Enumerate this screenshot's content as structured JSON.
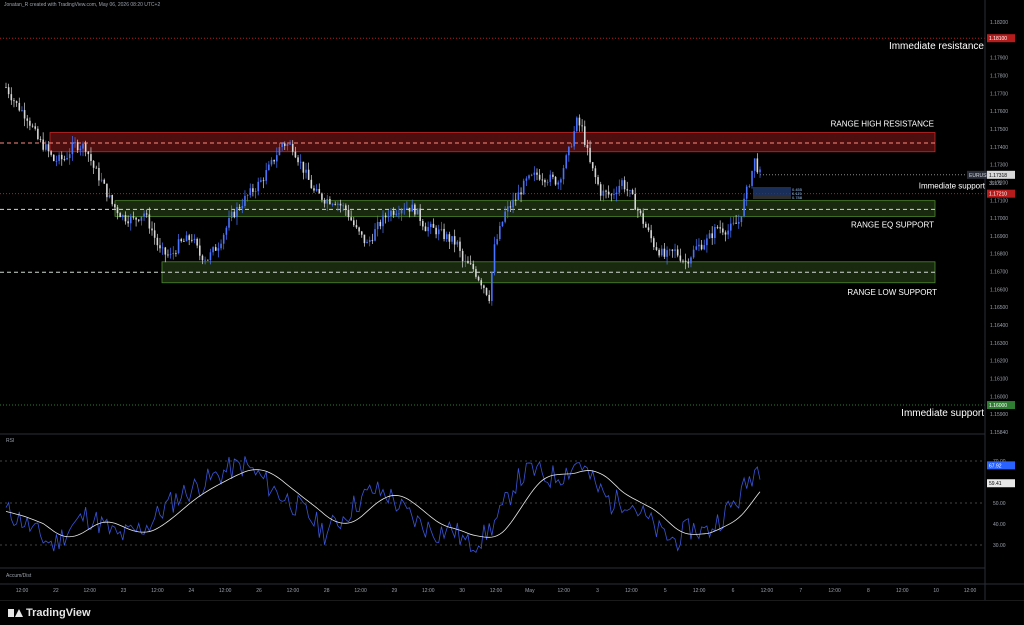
{
  "header": {
    "credit": "Jonatan_R created with TradingView.com, May 06, 2026 08:20 UTC+2"
  },
  "brand": {
    "name": "TradingView"
  },
  "colors": {
    "bull": "#4a74ff",
    "bear": "#d8d8d8",
    "resistance_zone": "#8b1a1a",
    "support_zone": "#2d4a1e",
    "rsi": "#3a55d8",
    "rsi_ma": "#e8e8e8",
    "red_level": "#b71c1c",
    "green_level": "#2e7d32"
  },
  "annotations": {
    "immediate_resistance": "Immediate resistance",
    "range_high": "RANGE HIGH RESISTANCE",
    "immediate_support_top": "Immediate support",
    "range_eq": "RANGE EQ SUPPORT",
    "range_low": "RANGE LOW SUPPORT",
    "immediate_support_bottom": "Immediate support"
  },
  "price_axis": {
    "ticks": [
      "1.18200",
      "1.18000",
      "1.17900",
      "1.17800",
      "1.17700",
      "1.17600",
      "1.17500",
      "1.17400",
      "1.17300",
      "1.17200",
      "1.17100",
      "1.17000",
      "1.16900",
      "1.16800",
      "1.16700",
      "1.16600",
      "1.16500",
      "1.16400",
      "1.16300",
      "1.16200",
      "1.16100",
      "1.16000",
      "1.15900",
      "1.15840"
    ],
    "red_marker": "1.18100",
    "green_marker": "1.16000",
    "symbol_tag": "EURUSD",
    "last_price": "1.17318",
    "countdown": "39:05",
    "red_small": "1.17210"
  },
  "pos_box": {
    "a": "0.455",
    "b": "0.121",
    "c": "0.788"
  },
  "time_axis": {
    "labels": [
      "12:00",
      "22",
      "12:00",
      "23",
      "12:00",
      "24",
      "12:00",
      "26",
      "12:00",
      "28",
      "12:00",
      "29",
      "12:00",
      "30",
      "12:00",
      "May",
      "12:00",
      "3",
      "12:00",
      "5",
      "12:00",
      "6",
      "12:00",
      "7",
      "12:00",
      "8",
      "12:00",
      "10",
      "12:00"
    ]
  },
  "rsi": {
    "label": "RSI",
    "ticks": [
      "70.00",
      "50.00",
      "40.00",
      "30.00"
    ],
    "value": "67.92",
    "ma_value": "59.41"
  },
  "bottom_panel": {
    "label": "Accum/Dist"
  },
  "chart_data": {
    "type": "candlestick",
    "symbol": "EURUSD",
    "ylim": [
      1.1584,
      1.1825
    ],
    "close_path": [
      [
        0,
        1.1782
      ],
      [
        4,
        1.1772
      ],
      [
        8,
        1.1765
      ],
      [
        12,
        1.1752
      ],
      [
        15,
        1.1747
      ],
      [
        18,
        1.174
      ],
      [
        22,
        1.1741
      ],
      [
        26,
        1.1749
      ],
      [
        30,
        1.1748
      ],
      [
        33,
        1.1736
      ],
      [
        36,
        1.1728
      ],
      [
        40,
        1.1715
      ],
      [
        44,
        1.1708
      ],
      [
        48,
        1.1706
      ],
      [
        52,
        1.171
      ],
      [
        55,
        1.17
      ],
      [
        58,
        1.1688
      ],
      [
        62,
        1.1685
      ],
      [
        65,
        1.1692
      ],
      [
        70,
        1.1696
      ],
      [
        73,
        1.1686
      ],
      [
        76,
        1.1684
      ],
      [
        80,
        1.1692
      ],
      [
        85,
        1.1708
      ],
      [
        90,
        1.1718
      ],
      [
        96,
        1.1728
      ],
      [
        100,
        1.1738
      ],
      [
        104,
        1.175
      ],
      [
        108,
        1.1748
      ],
      [
        112,
        1.1735
      ],
      [
        116,
        1.1722
      ],
      [
        120,
        1.1718
      ],
      [
        124,
        1.1717
      ],
      [
        128,
        1.1712
      ],
      [
        132,
        1.17
      ],
      [
        136,
        1.1692
      ],
      [
        140,
        1.1702
      ],
      [
        144,
        1.171
      ],
      [
        150,
        1.1714
      ],
      [
        154,
        1.1712
      ],
      [
        158,
        1.1702
      ],
      [
        162,
        1.17
      ],
      [
        166,
        1.1696
      ],
      [
        170,
        1.1692
      ],
      [
        172,
        1.1682
      ],
      [
        176,
        1.1678
      ],
      [
        180,
        1.1668
      ],
      [
        182,
        1.1662
      ],
      [
        184,
        1.169
      ],
      [
        188,
        1.171
      ],
      [
        192,
        1.1718
      ],
      [
        196,
        1.1728
      ],
      [
        200,
        1.1732
      ],
      [
        204,
        1.173
      ],
      [
        208,
        1.1728
      ],
      [
        212,
        1.1745
      ],
      [
        215,
        1.1762
      ],
      [
        217,
        1.1758
      ],
      [
        220,
        1.1738
      ],
      [
        224,
        1.1722
      ],
      [
        228,
        1.172
      ],
      [
        232,
        1.1728
      ],
      [
        236,
        1.1718
      ],
      [
        240,
        1.1705
      ],
      [
        244,
        1.1692
      ],
      [
        248,
        1.1685
      ],
      [
        252,
        1.1688
      ],
      [
        256,
        1.1682
      ],
      [
        260,
        1.169
      ],
      [
        264,
        1.1694
      ],
      [
        268,
        1.1702
      ],
      [
        272,
        1.17
      ],
      [
        276,
        1.1705
      ],
      [
        280,
        1.1728
      ],
      [
        282,
        1.174
      ],
      [
        284,
        1.1732
      ]
    ],
    "levels": [
      {
        "price": 1.181,
        "color": "red",
        "label": "Immediate resistance"
      },
      {
        "price": 1.175,
        "label": "RANGE HIGH RESISTANCE"
      },
      {
        "price": 1.1721,
        "color": "red",
        "label": "Immediate support"
      },
      {
        "price": 1.1712,
        "label": "RANGE EQ SUPPORT"
      },
      {
        "price": 1.1676,
        "label": "RANGE LOW SUPPORT"
      },
      {
        "price": 1.16,
        "color": "green",
        "label": "Immediate support"
      }
    ],
    "zones": [
      {
        "from": 1.1745,
        "to": 1.1756,
        "color": "red"
      },
      {
        "from": 1.1708,
        "to": 1.1717,
        "color": "green"
      },
      {
        "from": 1.167,
        "to": 1.1682,
        "color": "green"
      }
    ],
    "rsi": [
      [
        0,
        46
      ],
      [
        6,
        42
      ],
      [
        12,
        35
      ],
      [
        18,
        30
      ],
      [
        24,
        38
      ],
      [
        30,
        44
      ],
      [
        36,
        40
      ],
      [
        42,
        34
      ],
      [
        48,
        36
      ],
      [
        54,
        40
      ],
      [
        60,
        48
      ],
      [
        66,
        54
      ],
      [
        72,
        58
      ],
      [
        78,
        62
      ],
      [
        84,
        66
      ],
      [
        90,
        68
      ],
      [
        96,
        62
      ],
      [
        102,
        55
      ],
      [
        108,
        50
      ],
      [
        114,
        44
      ],
      [
        120,
        36
      ],
      [
        126,
        42
      ],
      [
        132,
        50
      ],
      [
        138,
        56
      ],
      [
        144,
        54
      ],
      [
        150,
        46
      ],
      [
        156,
        40
      ],
      [
        162,
        36
      ],
      [
        168,
        38
      ],
      [
        174,
        30
      ],
      [
        180,
        34
      ],
      [
        186,
        44
      ],
      [
        192,
        60
      ],
      [
        198,
        66
      ],
      [
        204,
        62
      ],
      [
        210,
        64
      ],
      [
        216,
        70
      ],
      [
        222,
        58
      ],
      [
        228,
        50
      ],
      [
        234,
        52
      ],
      [
        240,
        44
      ],
      [
        246,
        36
      ],
      [
        252,
        32
      ],
      [
        258,
        38
      ],
      [
        264,
        36
      ],
      [
        270,
        44
      ],
      [
        276,
        52
      ],
      [
        282,
        66
      ],
      [
        286,
        68
      ]
    ],
    "rsi_ylim": [
      20,
      80
    ]
  }
}
